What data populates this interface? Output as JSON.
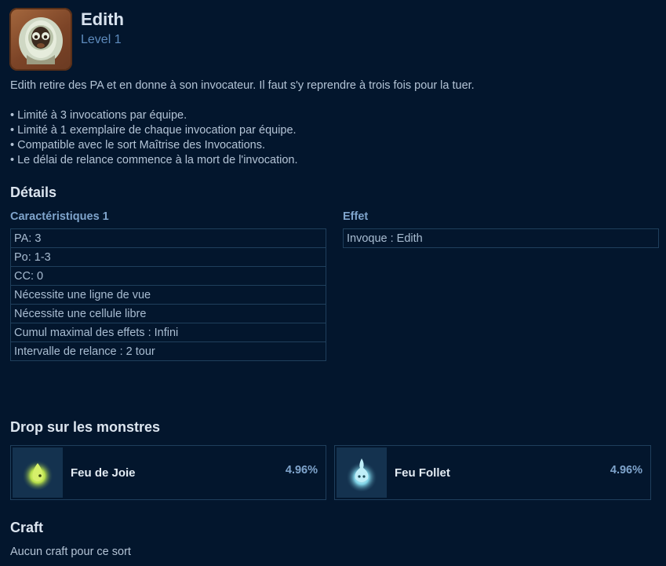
{
  "spell": {
    "name": "Edith",
    "level": "Level 1",
    "description": "Edith retire des PA et en donne à son invocateur. Il faut s'y reprendre à trois fois pour la tuer.",
    "notes": [
      "• Limité à 3 invocations par équipe.",
      "• Limité à 1 exemplaire de chaque invocation par équipe.",
      "• Compatible avec le sort Maîtrise des Invocations.",
      "• Le délai de relance commence à la mort de l'invocation."
    ]
  },
  "details": {
    "title": "Détails",
    "characteristics_title": "Caractéristiques 1",
    "characteristics": [
      "PA: 3",
      "Po: 1-3",
      "CC: 0",
      "Nécessite une ligne de vue",
      "Nécessite une cellule libre",
      "Cumul maximal des effets : Infini",
      "Intervalle de relance : 2 tour"
    ],
    "effect_title": "Effet",
    "effects": [
      "Invoque : Edith"
    ]
  },
  "drops": {
    "title": "Drop sur les monstres",
    "items": [
      {
        "name": "Feu de Joie",
        "rate": "4.96%",
        "icon": "feu-de-joie-icon"
      },
      {
        "name": "Feu Follet",
        "rate": "4.96%",
        "icon": "feu-follet-icon"
      }
    ]
  },
  "craft": {
    "title": "Craft",
    "text": "Aucun craft pour ce sort"
  }
}
